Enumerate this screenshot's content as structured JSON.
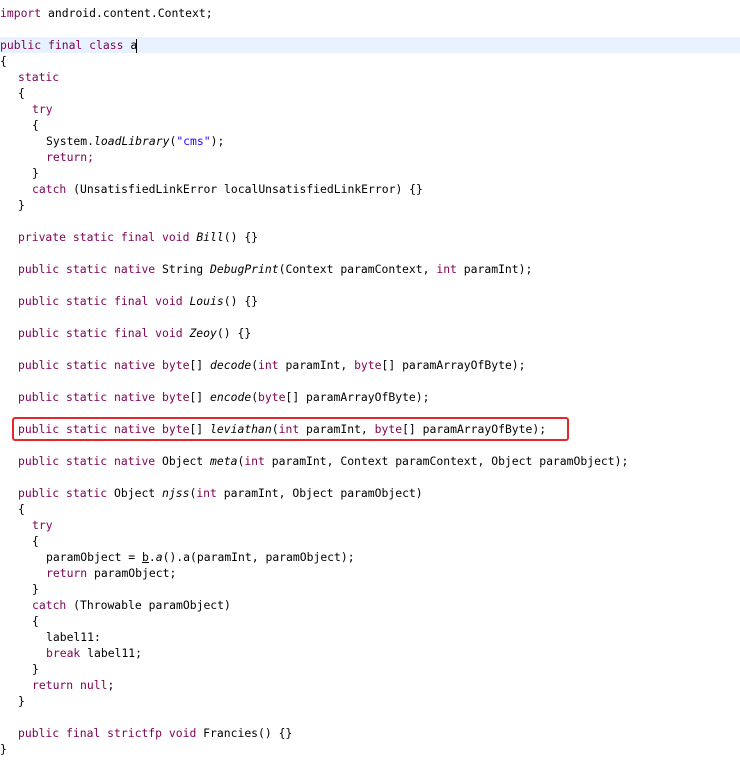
{
  "colors": {
    "keyword": "#7f0055",
    "string": "#2a00ff",
    "highlight_box": "#e5262a",
    "current_line": "#e8f2fe"
  },
  "code": {
    "l1": {
      "kw": "import",
      "rest": " android.content.Context;"
    },
    "l2": {
      "kw": "public final class",
      "sp": " ",
      "name": "a"
    },
    "l3": "{",
    "l4": "static",
    "l5": "{",
    "l6": "try",
    "l7": "{",
    "l8": {
      "a": "System.",
      "method": "loadLibrary",
      "b": "(",
      "str": "\"cms\"",
      "c": ");"
    },
    "l9": "return;",
    "l10": "}",
    "l11": {
      "kw": "catch",
      "rest": " (UnsatisfiedLinkError localUnsatisfiedLinkError) {}"
    },
    "l12": "}",
    "l13": {
      "kw": "private static final void",
      "sp": " ",
      "name": "Bill",
      "rest": "() {}"
    },
    "l14": {
      "kw": "public static native",
      "a": " String ",
      "name": "DebugPrint",
      "b": "(Context paramContext, ",
      "kw2": "int",
      "c": " paramInt);"
    },
    "l15": {
      "kw": "public static final void",
      "sp": " ",
      "name": "Louis",
      "rest": "() {}"
    },
    "l16": {
      "kw": "public static final void",
      "sp": " ",
      "name": "Zeoy",
      "rest": "() {}"
    },
    "l17": {
      "kw": "public static native",
      "sp": " ",
      "kw2": "byte",
      "a": "[] ",
      "name": "decode",
      "b": "(",
      "kw3": "int",
      "c": " paramInt, ",
      "kw4": "byte",
      "d": "[] paramArrayOfByte);"
    },
    "l18": {
      "kw": "public static native",
      "sp": " ",
      "kw2": "byte",
      "a": "[] ",
      "name": "encode",
      "b": "(",
      "kw3": "byte",
      "c": "[] paramArrayOfByte);"
    },
    "l19": {
      "kw": "public static native",
      "sp": " ",
      "kw2": "byte",
      "a": "[] ",
      "name": "leviathan",
      "b": "(",
      "kw3": "int",
      "c": " paramInt, ",
      "kw4": "byte",
      "d": "[] paramArrayOfByte);"
    },
    "l20": {
      "kw": "public static native",
      "a": " Object ",
      "name": "meta",
      "b": "(",
      "kw2": "int",
      "c": " paramInt, Context paramContext, Object paramObject);"
    },
    "l21": {
      "kw": "public static",
      "a": " Object ",
      "name": "njss",
      "b": "(",
      "kw2": "int",
      "c": " paramInt, Object paramObject)"
    },
    "l22": "{",
    "l23": "try",
    "l24": "{",
    "l25": {
      "a": "paramObject = ",
      "u": "b",
      "b": ".",
      "method": "a",
      "c": "().a(paramInt, paramObject);"
    },
    "l26": {
      "kw": "return",
      "rest": " paramObject;"
    },
    "l27": "}",
    "l28": {
      "kw": "catch",
      "rest": " (Throwable paramObject)"
    },
    "l29": "{",
    "l30": "label11:",
    "l31": {
      "kw": "break",
      "rest": " label11;"
    },
    "l32": "}",
    "l33": {
      "kw": "return null",
      "rest": ";"
    },
    "l34": "}",
    "l35": {
      "kw": "public final strictfp void",
      "rest": " Francies() {}"
    },
    "l36": "}"
  }
}
